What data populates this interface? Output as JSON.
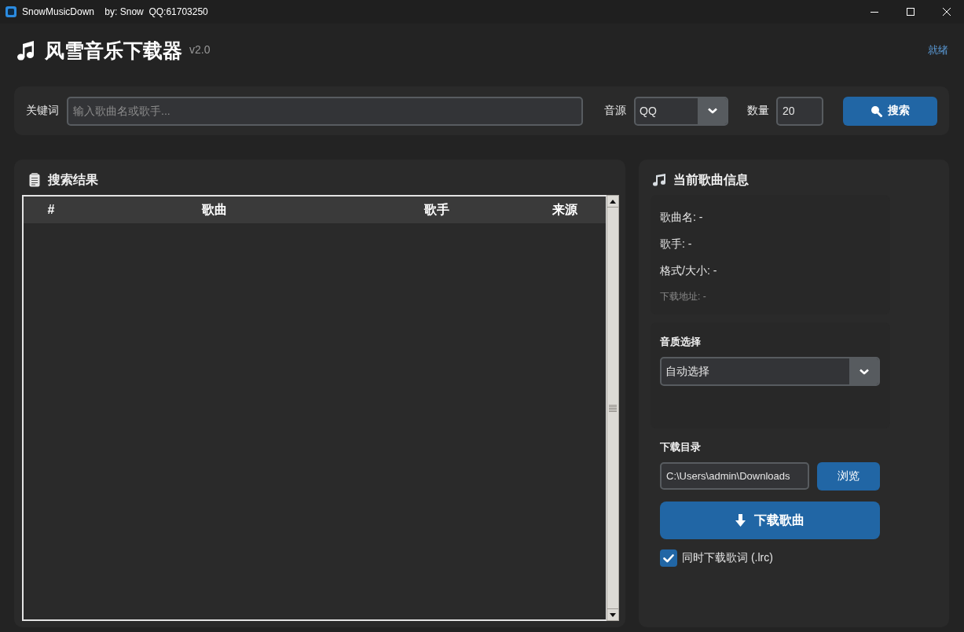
{
  "window": {
    "title": "SnowMusicDown    by: Snow  QQ:61703250"
  },
  "header": {
    "title": "风雪音乐下载器",
    "version": "v2.0",
    "status": "就绪"
  },
  "search_bar": {
    "keyword_label": "关键词",
    "keyword_field": {
      "placeholder": "输入歌曲名或歌手..."
    },
    "source_label": "音源",
    "source_select": {
      "value": "QQ"
    },
    "count_label": "数量",
    "count_field": {
      "value": "20"
    },
    "search_button": "搜索"
  },
  "results": {
    "title": "搜索结果",
    "table": {
      "columns": [
        "#",
        "歌曲",
        "歌手",
        "来源"
      ]
    }
  },
  "song_info": {
    "title": "当前歌曲信息",
    "fields": [
      {
        "kind": "field",
        "text": "歌曲名: -"
      },
      {
        "kind": "field",
        "text": "歌手: -"
      },
      {
        "kind": "field",
        "text": "格式/大小: -"
      },
      {
        "kind": "note",
        "text": "下载地址: -"
      }
    ]
  },
  "quality": {
    "label": "音质选择",
    "select": {
      "value": "自动选择"
    }
  },
  "download_dir": {
    "label": "下载目录",
    "path_field": {
      "value": "C:\\Users\\admin\\Downloads"
    },
    "browse_button": "浏览"
  },
  "download_button": "下载歌曲",
  "lyrics_option": {
    "label": "同时下载歌词 (.lrc)",
    "checked": true
  }
}
